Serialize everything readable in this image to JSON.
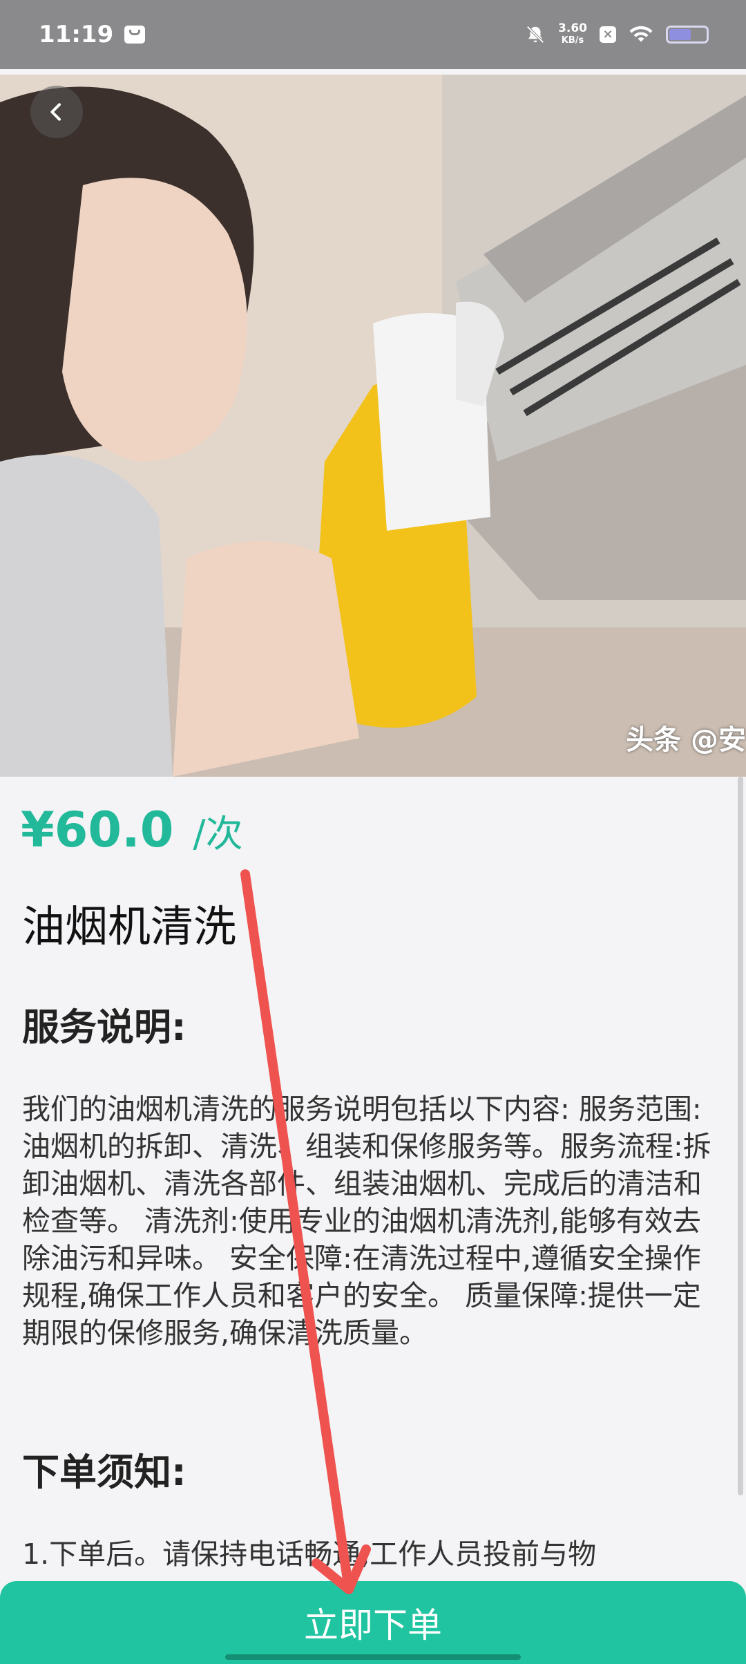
{
  "status_bar": {
    "time": "11:19",
    "net_speed_value": "3.60",
    "net_speed_unit": "KB/s",
    "battery_level": 0.6
  },
  "hero": {
    "watermark": "头条 @安"
  },
  "service": {
    "price": "¥60.0",
    "unit": "/次",
    "name": "油烟机清洗",
    "desc_heading": "服务说明:",
    "description": "我们的油烟机清洗的服务说明包括以下内容: 服务范围:油烟机的拆卸、清洗、组装和保修服务等。服务流程:拆卸油烟机、清洗各部件、组装油烟机、完成后的清洁和检查等。 清洗剂:使用专业的油烟机清洗剂,能够有效去除油污和异味。 安全保障:在清洗过程中,遵循安全操作规程,确保工作人员和客户的安全。 质量保障:提供一定期限的保修服务,确保清洗质量。",
    "notice_heading": "下单须知:",
    "notice_text": "1.下单后。请保持电话畅通,工作人员投前与物"
  },
  "actions": {
    "order_label": "立即下单"
  },
  "colors": {
    "accent": "#22b89a",
    "button": "#20c4a0",
    "annotation_arrow": "#ef5350"
  }
}
